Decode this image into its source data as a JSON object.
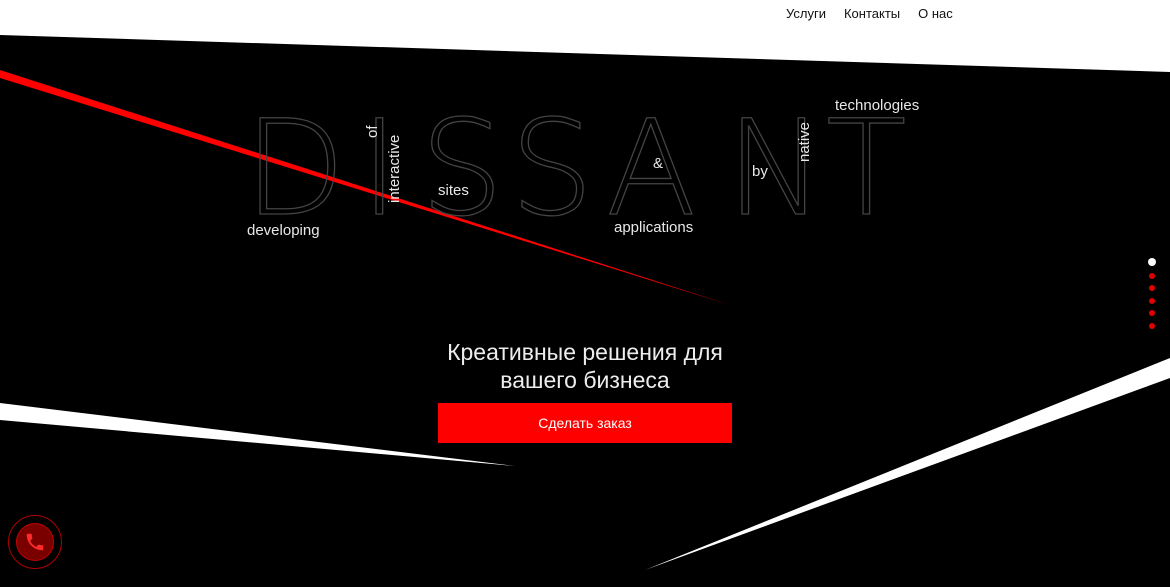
{
  "nav": {
    "items": [
      "Услуги",
      "Контакты",
      "О нас"
    ]
  },
  "logo": {
    "letters": [
      "D",
      "I",
      "S",
      "S",
      "A",
      "N",
      "T"
    ]
  },
  "tagline_words": {
    "developing": "developing",
    "of": "of",
    "interactive": "interactive",
    "sites": "sites",
    "ampersand": "&",
    "applications": "applications",
    "by": "by",
    "native": "native",
    "technologies": "technologies"
  },
  "hero": {
    "headline_line1": "Креативные решения для",
    "headline_line2": "вашего бизнеса",
    "cta_label": "Сделать заказ"
  },
  "slider": {
    "count": 6,
    "active_index": 0
  },
  "colors": {
    "accent": "#ff0000",
    "background": "#000000",
    "stripe": "#ffffff"
  },
  "icons": {
    "call": "phone-icon"
  }
}
